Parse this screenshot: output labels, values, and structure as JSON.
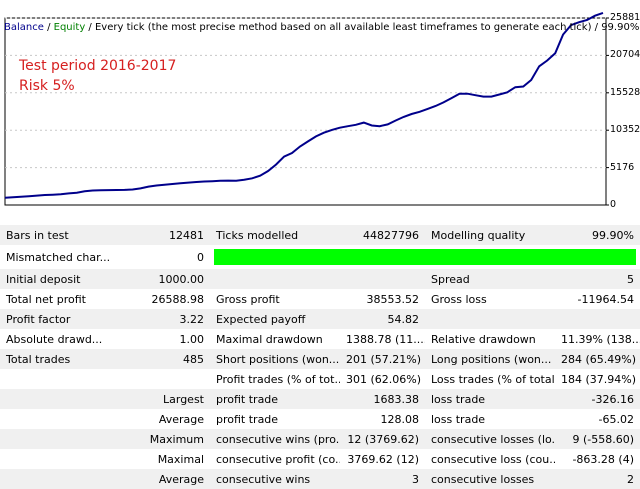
{
  "header": {
    "balance": "Balance",
    "sep1": " / ",
    "equity": "Equity",
    "rest": " / Every tick (the most precise method based on all available least timeframes to generate each tick) / 99.90%"
  },
  "overlay": {
    "line1": "Test period 2016-2017",
    "line2": "Risk 5%"
  },
  "colors": {
    "balance_line": "#00008b",
    "quality_bar": "#00ff00",
    "overlay_text": "#d62020",
    "equity_label": "#008000"
  },
  "chart_data": {
    "type": "line",
    "series": [
      {
        "name": "Balance",
        "values": [
          1000,
          1080,
          1150,
          1220,
          1300,
          1380,
          1430,
          1480,
          1600,
          1700,
          1900,
          2010,
          2050,
          2060,
          2080,
          2090,
          2150,
          2300,
          2550,
          2700,
          2800,
          2900,
          3000,
          3100,
          3180,
          3250,
          3300,
          3350,
          3380,
          3350,
          3500,
          3700,
          4050,
          4700,
          5600,
          6700,
          7200,
          8100,
          8800,
          9500,
          10000,
          10400,
          10700,
          10900,
          11100,
          11400,
          11000,
          10900,
          11150,
          11700,
          12200,
          12600,
          12900,
          13300,
          13700,
          14200,
          14800,
          15400,
          15400,
          15200,
          15000,
          15000,
          15300,
          15600,
          16300,
          16400,
          17300,
          19200,
          20000,
          21000,
          23600,
          24900,
          25300,
          25600,
          26200,
          26589
        ]
      }
    ],
    "y_ticks": [
      "0",
      "5176",
      "10352",
      "15528",
      "20704",
      "25881"
    ],
    "ylim": [
      0,
      25881
    ],
    "grid": true
  },
  "stats_rows": [
    [
      "Bars in test",
      "12481",
      "Ticks modelled",
      "44827796",
      "Modelling quality",
      "99.90%"
    ],
    [
      "Mismatched char...",
      "0",
      "",
      "",
      "",
      ""
    ],
    [
      "Initial deposit",
      "1000.00",
      "",
      "",
      "Spread",
      "5"
    ],
    [
      "Total net profit",
      "26588.98",
      "Gross profit",
      "38553.52",
      "Gross loss",
      "-11964.54"
    ],
    [
      "Profit factor",
      "3.22",
      "Expected payoff",
      "54.82",
      "",
      ""
    ],
    [
      "Absolute drawd...",
      "1.00",
      "Maximal drawdown",
      "1388.78 (11....",
      "Relative drawdown",
      "11.39% (138..."
    ],
    [
      "Total trades",
      "485",
      "Short positions (won...",
      "201 (57.21%)",
      "Long positions (won...",
      "284 (65.49%)"
    ],
    [
      "",
      "",
      "Profit trades (% of tot...",
      "301 (62.06%)",
      "Loss trades (% of total)",
      "184 (37.94%)"
    ],
    [
      "",
      "Largest",
      "profit trade",
      "1683.38",
      "loss trade",
      "-326.16"
    ],
    [
      "",
      "Average",
      "profit trade",
      "128.08",
      "loss trade",
      "-65.02"
    ],
    [
      "",
      "Maximum",
      "consecutive wins (pro...",
      "12 (3769.62)",
      "consecutive losses (lo...",
      "9 (-558.60)"
    ],
    [
      "",
      "Maximal",
      "consecutive profit (co...",
      "3769.62 (12)",
      "consecutive loss (cou...",
      "-863.28 (4)"
    ],
    [
      "",
      "Average",
      "consecutive wins",
      "3",
      "consecutive losses",
      "2"
    ]
  ],
  "modelling_quality_fraction": 0.999
}
